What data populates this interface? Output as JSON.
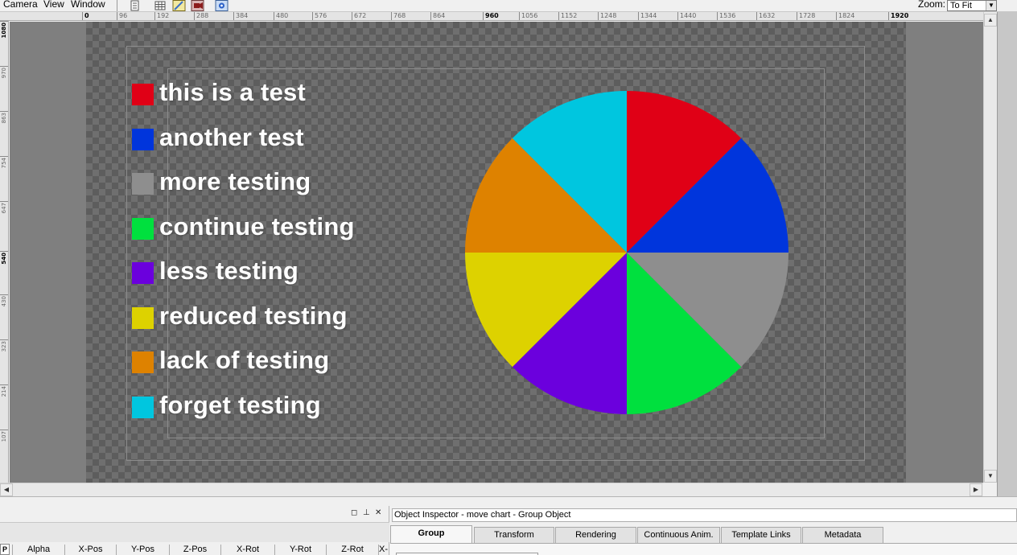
{
  "menu": {
    "items": [
      "Camera",
      "View",
      "Window"
    ],
    "zoom_label": "Zoom:",
    "zoom_value": "To Fit"
  },
  "ruler": {
    "h_ticks": [
      "0",
      "96",
      "192",
      "288",
      "384",
      "480",
      "576",
      "672",
      "768",
      "864",
      "960",
      "1056",
      "1152",
      "1248",
      "1344",
      "1440",
      "1536",
      "1632",
      "1728",
      "1824",
      "1920"
    ],
    "v_ticks": [
      "1080",
      "970",
      "863",
      "754",
      "647",
      "540",
      "430",
      "323",
      "214",
      "107"
    ]
  },
  "chart_data": {
    "type": "pie",
    "title": "",
    "slices": [
      {
        "label": "this is a test",
        "value": 12.5,
        "color": "#e00016"
      },
      {
        "label": "another test",
        "value": 12.5,
        "color": "#0035dc"
      },
      {
        "label": "more testing",
        "value": 12.5,
        "color": "#8e8e8e"
      },
      {
        "label": "continue testing",
        "value": 12.5,
        "color": "#00e03e"
      },
      {
        "label": "less testing",
        "value": 12.5,
        "color": "#6b00dd"
      },
      {
        "label": "reduced testing",
        "value": 12.5,
        "color": "#ddd200"
      },
      {
        "label": "lack of testing",
        "value": 12.5,
        "color": "#de8200"
      },
      {
        "label": "forget testing",
        "value": 12.5,
        "color": "#00c6df"
      }
    ],
    "legend_position": "left"
  },
  "bottom_left": {
    "columns": [
      "Alpha",
      "X-Pos",
      "Y-Pos",
      "Z-Pos",
      "X-Rot",
      "Y-Rot",
      "Z-Rot",
      "X-"
    ],
    "icon_letter": "P"
  },
  "inspector": {
    "title": "Object Inspector - move chart - Group Object",
    "tabs": [
      "Group",
      "Transform",
      "Rendering",
      "Continuous Anim.",
      "Template Links",
      "Metadata"
    ],
    "active_tab": "Group"
  }
}
